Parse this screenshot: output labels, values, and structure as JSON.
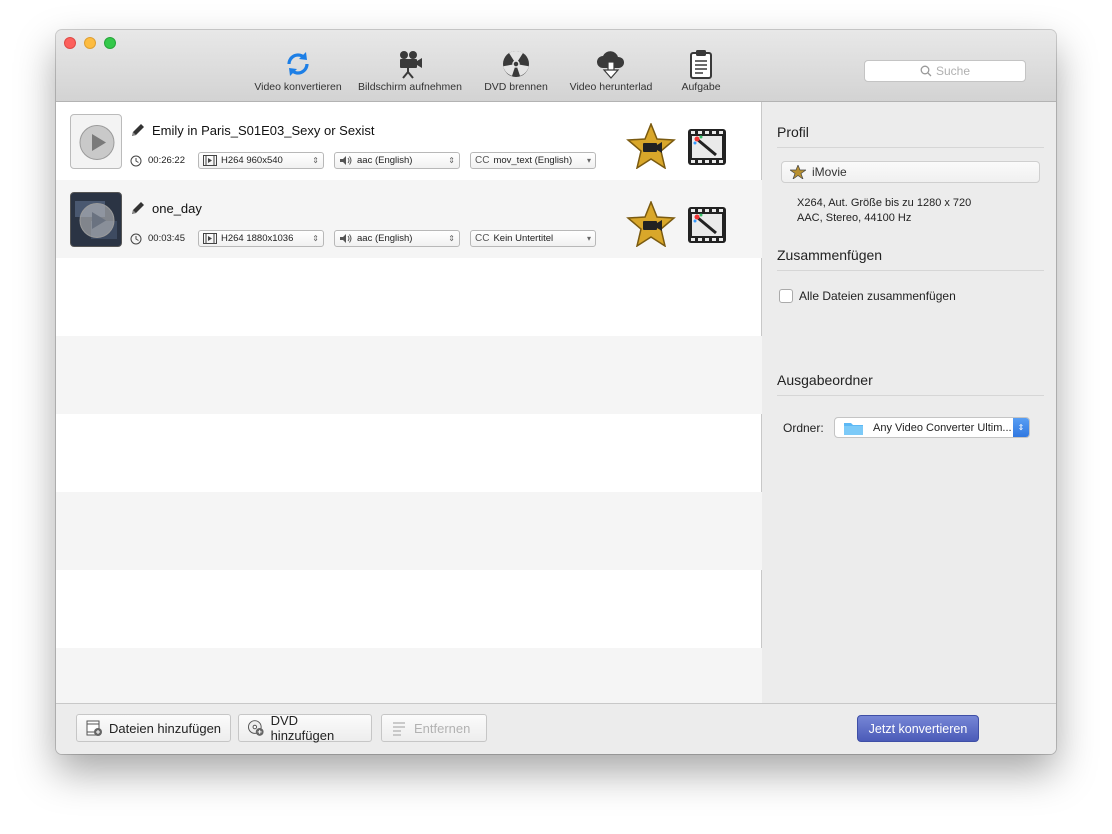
{
  "toolbar": {
    "items": [
      {
        "label": "Video konvertieren",
        "icon": "refresh-icon"
      },
      {
        "label": "Bildschirm aufnehmen",
        "icon": "camera-icon"
      },
      {
        "label": "DVD brennen",
        "icon": "burn-icon"
      },
      {
        "label": "Video herunterlad",
        "icon": "cloud-download-icon"
      },
      {
        "label": "Aufgabe",
        "icon": "clipboard-icon"
      }
    ],
    "search_placeholder": "Suche"
  },
  "files": [
    {
      "title": "Emily in Paris_S01E03_Sexy or Sexist",
      "duration": "00:26:22",
      "video": "H264 960x540",
      "audio": "aac (English)",
      "subtitle": "mov_text (English)"
    },
    {
      "title": "one_day",
      "duration": "00:03:45",
      "video": "H264 1880x1036",
      "audio": "aac (English)",
      "subtitle": "Kein Untertitel"
    }
  ],
  "side": {
    "profile_title": "Profil",
    "profile_name": "iMovie",
    "profile_desc_line1": "X264, Aut. Größe bis zu 1280 x 720",
    "profile_desc_line2": "AAC, Stereo, 44100 Hz",
    "merge_title": "Zusammenfügen",
    "merge_checkbox": "Alle Dateien zusammenfügen",
    "output_title": "Ausgabeordner",
    "folder_label": "Ordner:",
    "folder_value": "Any Video Converter Ultim..."
  },
  "bottom": {
    "add_files": "Dateien hinzufügen",
    "add_dvd": "DVD hinzufügen",
    "remove": "Entfernen",
    "convert": "Jetzt konvertieren"
  },
  "cc_label": "CC",
  "colors": {
    "accent": "#4b5bb8",
    "refresh_blue": "#1d7fe6"
  }
}
